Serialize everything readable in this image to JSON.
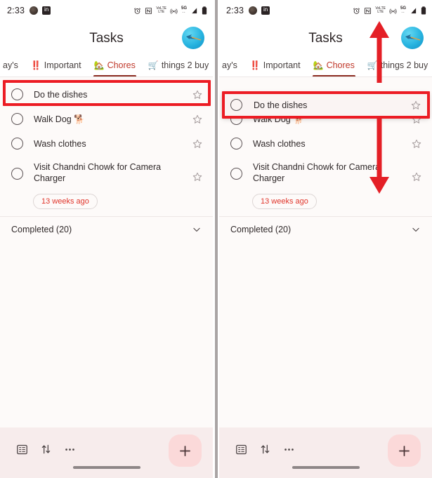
{
  "meta": {
    "app_title": "Tasks",
    "panel_count": 2
  },
  "status_bar": {
    "time": "2:33",
    "left_icons": [
      "profile-avatar-icon",
      "linkedin-icon"
    ],
    "right_icons": [
      "alarm-icon",
      "nfc-icon",
      "volte-icon",
      "hotspot-icon",
      "5g-icon",
      "signal-bars-icon",
      "battery-icon"
    ],
    "volte_label_top": "VoLTE",
    "volte_label_bottom": "LTE",
    "fiveg_label": "5G"
  },
  "header": {
    "title": "Tasks",
    "avatar_name": "account-avatar"
  },
  "tabs": [
    {
      "label": "ay's",
      "emoji": "",
      "active": false,
      "truncated": true
    },
    {
      "label": "Important",
      "emoji": "‼️",
      "active": false,
      "truncated": false
    },
    {
      "label": "Chores",
      "emoji": "🏡",
      "active": true,
      "truncated": false
    },
    {
      "label": "things 2 buy",
      "emoji": "🛒",
      "active": false,
      "truncated": false
    }
  ],
  "tasks": [
    {
      "title": "Do the dishes",
      "starred": false,
      "chip": ""
    },
    {
      "title": "Walk Dog 🐕",
      "starred": false,
      "chip": ""
    },
    {
      "title": "Wash clothes",
      "starred": false,
      "chip": ""
    },
    {
      "title": "Visit Chandni Chowk for Camera Charger",
      "starred": false,
      "chip": "13 weeks ago"
    }
  ],
  "completed": {
    "label": "Completed (20)",
    "count": 20,
    "expand_icon": "chevron-down-icon"
  },
  "bottom_bar": {
    "icons": [
      "switch-list-icon",
      "sort-icon",
      "more-options-icon"
    ],
    "fab_label": "+",
    "fab_name": "add-task-button"
  },
  "annotations": {
    "left_highlight_target": "Do the dishes",
    "right_highlight_target": "Do the dishes",
    "arrow_up_name": "drag-up-arrow",
    "arrow_down_name": "drag-down-arrow",
    "highlight_color": "#ec1c24"
  },
  "colors": {
    "accent_red": "#c0392b",
    "chip_text": "#e0352b",
    "fab_bg": "#fbd9d9",
    "bottom_bar_bg": "#f7ecec",
    "panel_bg": "#fdfaf9",
    "tab_underline": "#8c2d22"
  }
}
